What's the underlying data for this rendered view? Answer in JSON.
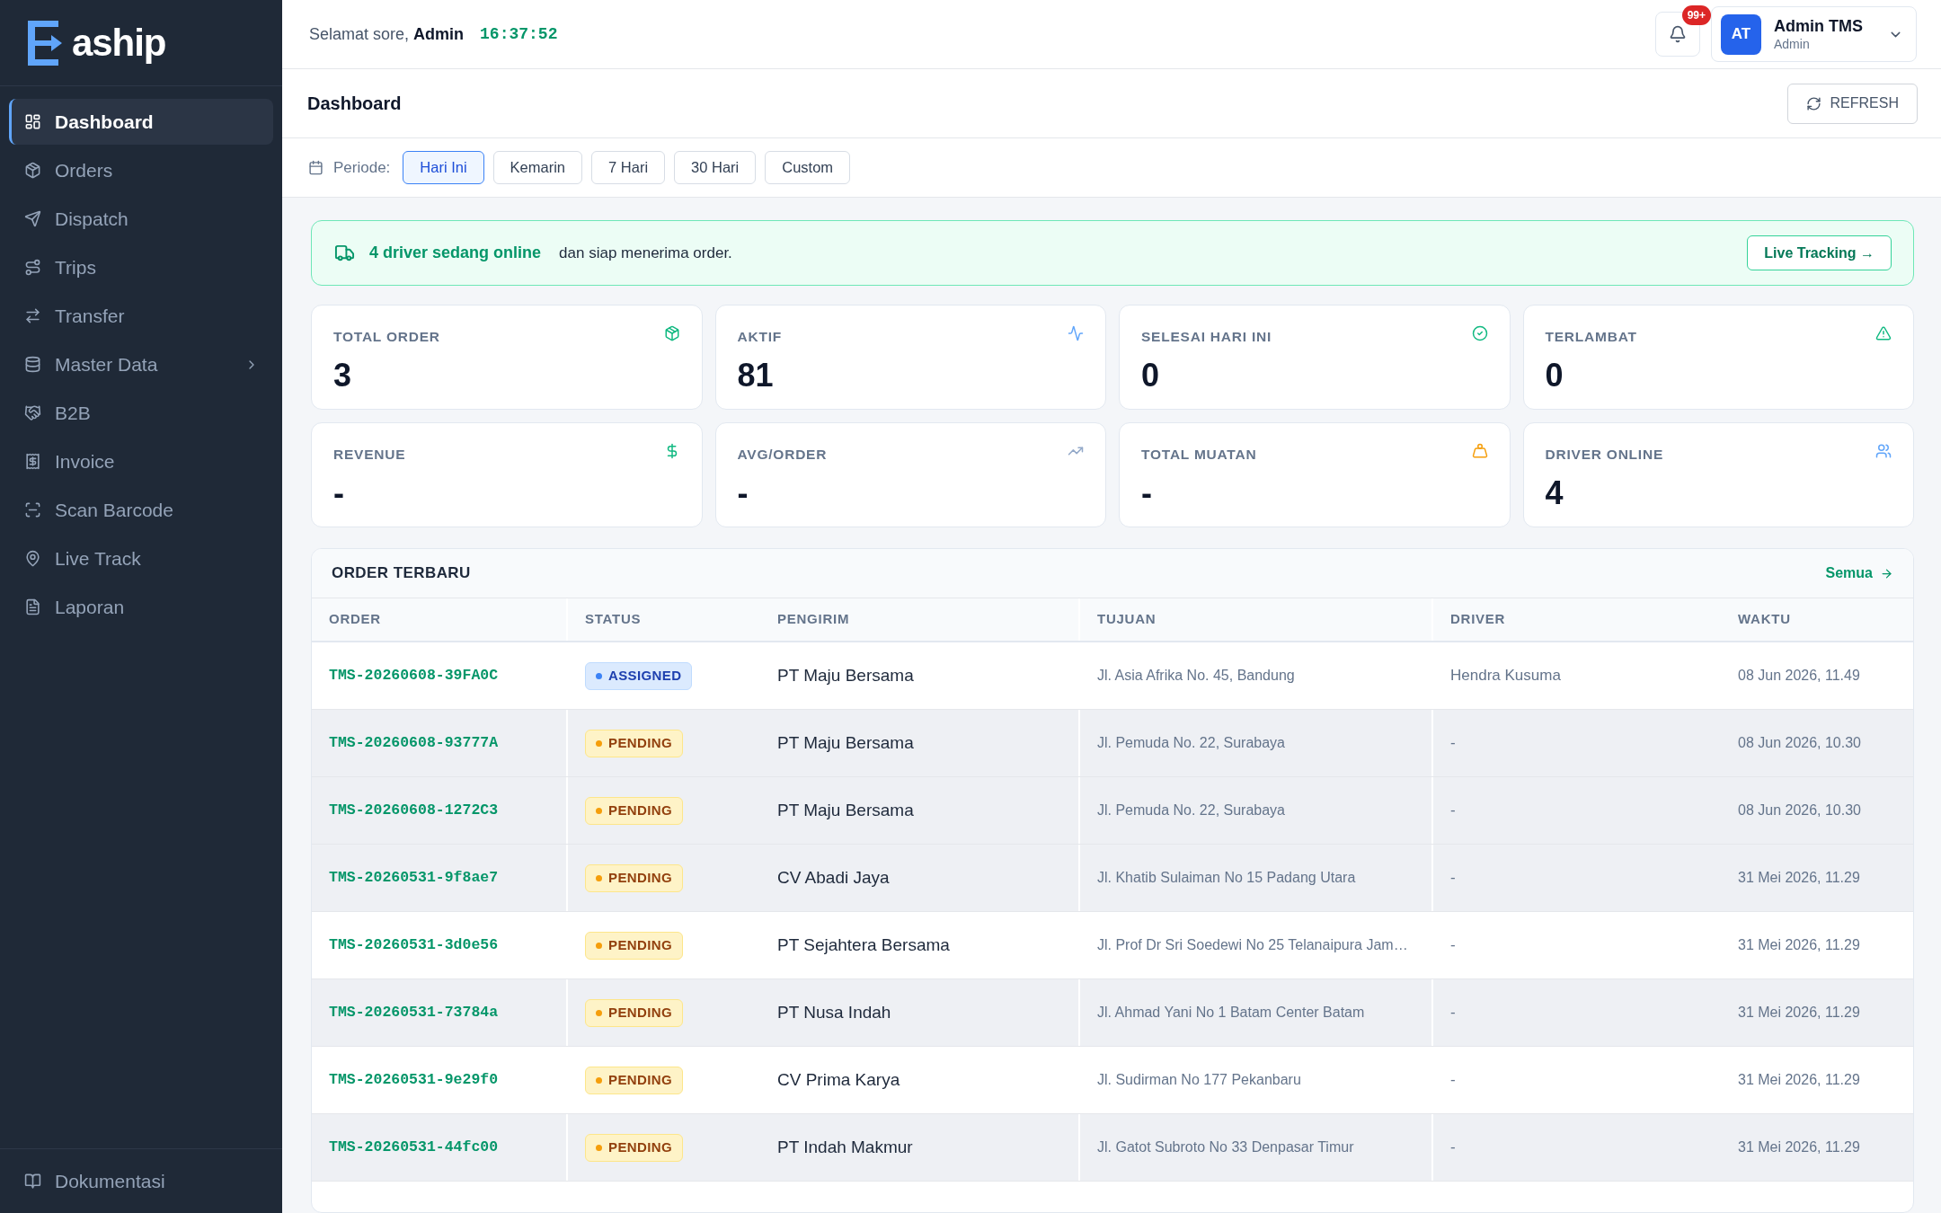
{
  "sidebar": {
    "logo": "aship",
    "items": [
      {
        "label": "Dashboard",
        "kind": "link",
        "selected": true
      },
      {
        "label": "Orders",
        "kind": "link",
        "selected": false
      },
      {
        "label": "Dispatch",
        "kind": "link",
        "selected": false
      },
      {
        "label": "Trips",
        "kind": "link",
        "selected": false
      },
      {
        "label": "Transfer",
        "kind": "link",
        "selected": false
      },
      {
        "label": "Master Data",
        "kind": "group",
        "selected": false,
        "expanded": false
      },
      {
        "label": "B2B",
        "kind": "link",
        "selected": false
      },
      {
        "label": "Invoice",
        "kind": "link",
        "selected": false
      },
      {
        "label": "Scan Barcode",
        "kind": "link",
        "selected": false
      },
      {
        "label": "Live Track",
        "kind": "link",
        "selected": false
      },
      {
        "label": "Laporan",
        "kind": "link",
        "selected": false
      }
    ],
    "footer_link": "Dokumentasi"
  },
  "header": {
    "greeting": "Selamat sore, **Admin**",
    "clock": "16:37:52",
    "notification_badge": "99+",
    "user": {
      "initials": "AT",
      "name": "Admin TMS",
      "role": "Admin"
    }
  },
  "page": {
    "title": "Dashboard",
    "refresh_button": "REFRESH"
  },
  "period": {
    "label": "Periode:",
    "options": [
      {
        "label": "Hari Ini",
        "selected": true
      },
      {
        "label": "Kemarin",
        "selected": false
      },
      {
        "label": "7 Hari",
        "selected": false
      },
      {
        "label": "30 Hari",
        "selected": false
      },
      {
        "label": "Custom",
        "selected": false
      }
    ]
  },
  "banner": {
    "highlight": "4 driver sedang online",
    "message": "dan siap menerima order.",
    "action": "Live Tracking →"
  },
  "stats": [
    {
      "label": "TOTAL ORDER",
      "value": "3"
    },
    {
      "label": "AKTIF",
      "value": "81"
    },
    {
      "label": "SELESAI HARI INI",
      "value": "0"
    },
    {
      "label": "TERLAMBAT",
      "value": "0"
    },
    {
      "label": "REVENUE",
      "value": "-"
    },
    {
      "label": "AVG/ORDER",
      "value": "-"
    },
    {
      "label": "TOTAL MUATAN",
      "value": "-"
    },
    {
      "label": "DRIVER ONLINE",
      "value": "4"
    }
  ],
  "orders": {
    "title": "ORDER TERBARU",
    "view_all": "Semua",
    "columns": [
      "ORDER",
      "STATUS",
      "PENGIRIM",
      "TUJUAN",
      "DRIVER",
      "WAKTU"
    ],
    "rows": [
      {
        "order": "TMS-20260608-39FA0C",
        "status": {
          "label": "ASSIGNED",
          "kind": "assigned"
        },
        "sender": "PT Maju Bersama",
        "destination": "Jl. Asia Afrika No. 45, Bandung",
        "driver": "Hendra Kusuma",
        "time": "08 Jun 2026, 11.49",
        "shaded": false
      },
      {
        "order": "TMS-20260608-93777A",
        "status": {
          "label": "PENDING",
          "kind": "pending"
        },
        "sender": "PT Maju Bersama",
        "destination": "Jl. Pemuda No. 22, Surabaya",
        "driver": "-",
        "time": "08 Jun 2026, 10.30",
        "shaded": true
      },
      {
        "order": "TMS-20260608-1272C3",
        "status": {
          "label": "PENDING",
          "kind": "pending"
        },
        "sender": "PT Maju Bersama",
        "destination": "Jl. Pemuda No. 22, Surabaya",
        "driver": "-",
        "time": "08 Jun 2026, 10.30",
        "shaded": true
      },
      {
        "order": "TMS-20260531-9f8ae7",
        "status": {
          "label": "PENDING",
          "kind": "pending"
        },
        "sender": "CV Abadi Jaya",
        "destination": "Jl. Khatib Sulaiman No 15 Padang Utara",
        "driver": "-",
        "time": "31 Mei 2026, 11.29",
        "shaded": true
      },
      {
        "order": "TMS-20260531-3d0e56",
        "status": {
          "label": "PENDING",
          "kind": "pending"
        },
        "sender": "PT Sejahtera Bersama",
        "destination": "Jl. Prof Dr Sri Soedewi No 25 Telanaipura Jam…",
        "driver": "-",
        "time": "31 Mei 2026, 11.29",
        "shaded": false
      },
      {
        "order": "TMS-20260531-73784a",
        "status": {
          "label": "PENDING",
          "kind": "pending"
        },
        "sender": "PT Nusa Indah",
        "destination": "Jl. Ahmad Yani No 1 Batam Center Batam",
        "driver": "-",
        "time": "31 Mei 2026, 11.29",
        "shaded": true
      },
      {
        "order": "TMS-20260531-9e29f0",
        "status": {
          "label": "PENDING",
          "kind": "pending"
        },
        "sender": "CV Prima Karya",
        "destination": "Jl. Sudirman No 177 Pekanbaru",
        "driver": "-",
        "time": "31 Mei 2026, 11.29",
        "shaded": false
      },
      {
        "order": "TMS-20260531-44fc00",
        "status": {
          "label": "PENDING",
          "kind": "pending"
        },
        "sender": "PT Indah Makmur",
        "destination": "Jl. Gatot Subroto No 33 Denpasar Timur",
        "driver": "-",
        "time": "31 Mei 2026, 11.29",
        "shaded": true
      }
    ]
  }
}
